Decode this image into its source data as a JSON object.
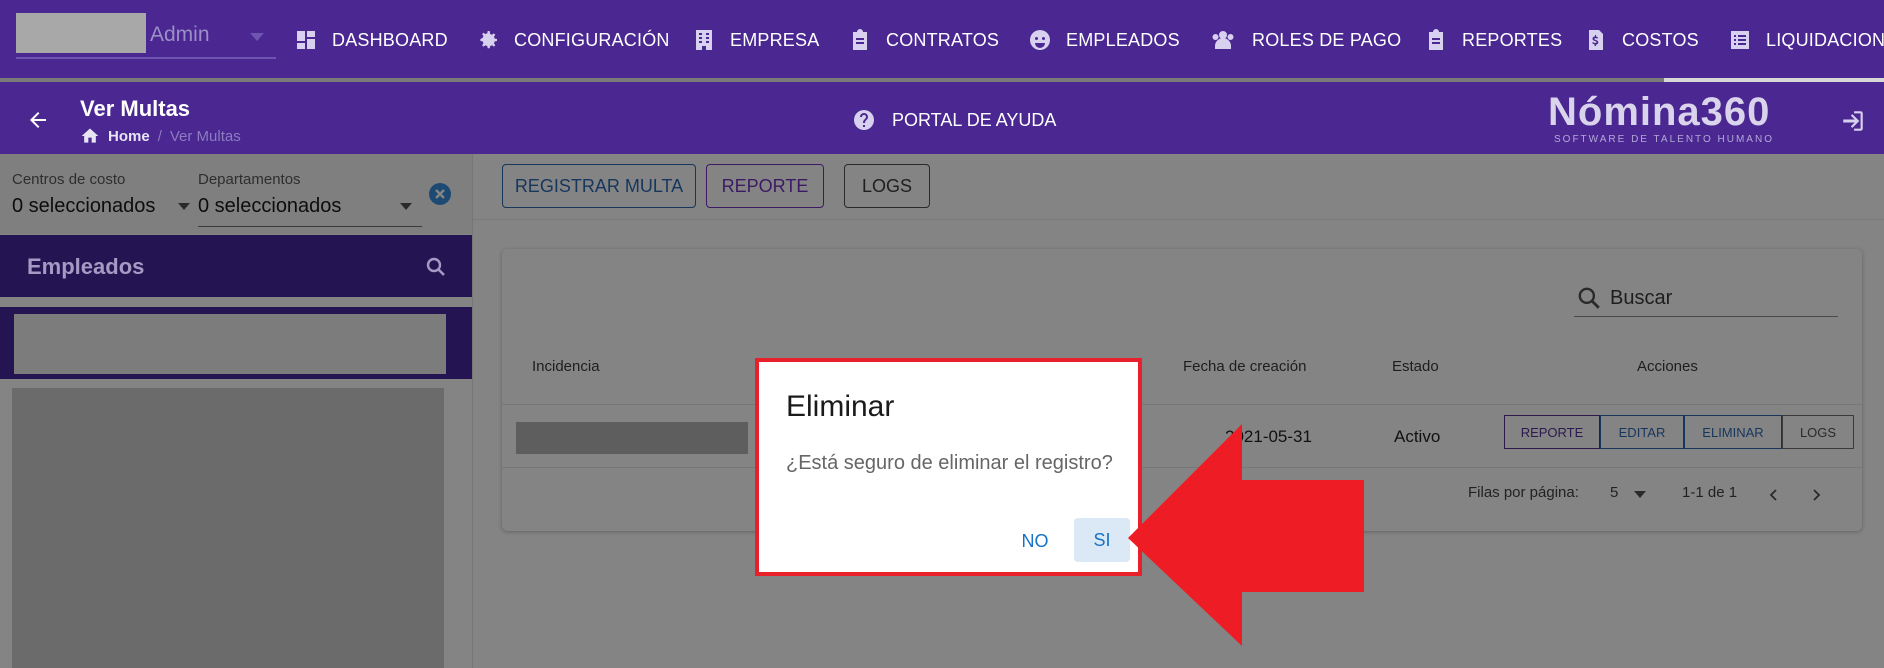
{
  "user": {
    "name": "Admin"
  },
  "nav": {
    "items": [
      {
        "label": "DASHBOARD",
        "icon": "dashboard-icon"
      },
      {
        "label": "CONFIGURACIÓN",
        "icon": "gear-icon"
      },
      {
        "label": "EMPRESA",
        "icon": "building-icon"
      },
      {
        "label": "CONTRATOS",
        "icon": "clipboard-icon"
      },
      {
        "label": "EMPLEADOS",
        "icon": "face-icon"
      },
      {
        "label": "ROLES DE PAGO",
        "icon": "people-icon"
      },
      {
        "label": "REPORTES",
        "icon": "clipboard-icon"
      },
      {
        "label": "COSTOS",
        "icon": "invoice-dollar-icon"
      },
      {
        "label": "LIQUIDACIONES",
        "icon": "list-icon"
      }
    ]
  },
  "header": {
    "title": "Ver Multas",
    "breadcrumb_home": "Home",
    "breadcrumb_sep": "/",
    "breadcrumb_current": "Ver Multas",
    "help": "PORTAL DE AYUDA",
    "logo": "Nómina360",
    "logo_tagline": "SOFTWARE DE TALENTO HUMANO"
  },
  "filters": {
    "cost_center_label": "Centros de costo",
    "cost_center_value": "0 seleccionados",
    "department_label": "Departamentos",
    "department_value": "0 seleccionados"
  },
  "employees": {
    "title": "Empleados"
  },
  "toolbar": {
    "register": "REGISTRAR MULTA",
    "report": "REPORTE",
    "logs": "LOGS"
  },
  "table": {
    "search_placeholder": "Buscar",
    "headers": {
      "incidence": "Incidencia",
      "created": "Fecha de creación",
      "status": "Estado",
      "actions": "Acciones"
    },
    "rows": [
      {
        "created": "2021-05-31",
        "status": "Activo"
      }
    ],
    "row_actions": {
      "report": "REPORTE",
      "edit": "EDITAR",
      "delete": "ELIMINAR",
      "logs": "LOGS"
    },
    "rows_per_page_label": "Filas por página:",
    "rows_per_page": "5",
    "range": "1-1 de 1"
  },
  "dialog": {
    "title": "Eliminar",
    "message": "¿Está seguro de eliminar el registro?",
    "no": "NO",
    "yes": "SI"
  },
  "colors": {
    "brand_purple": "#4a2791",
    "dialog_highlight": "#e8202a",
    "link_blue": "#1672c4"
  }
}
